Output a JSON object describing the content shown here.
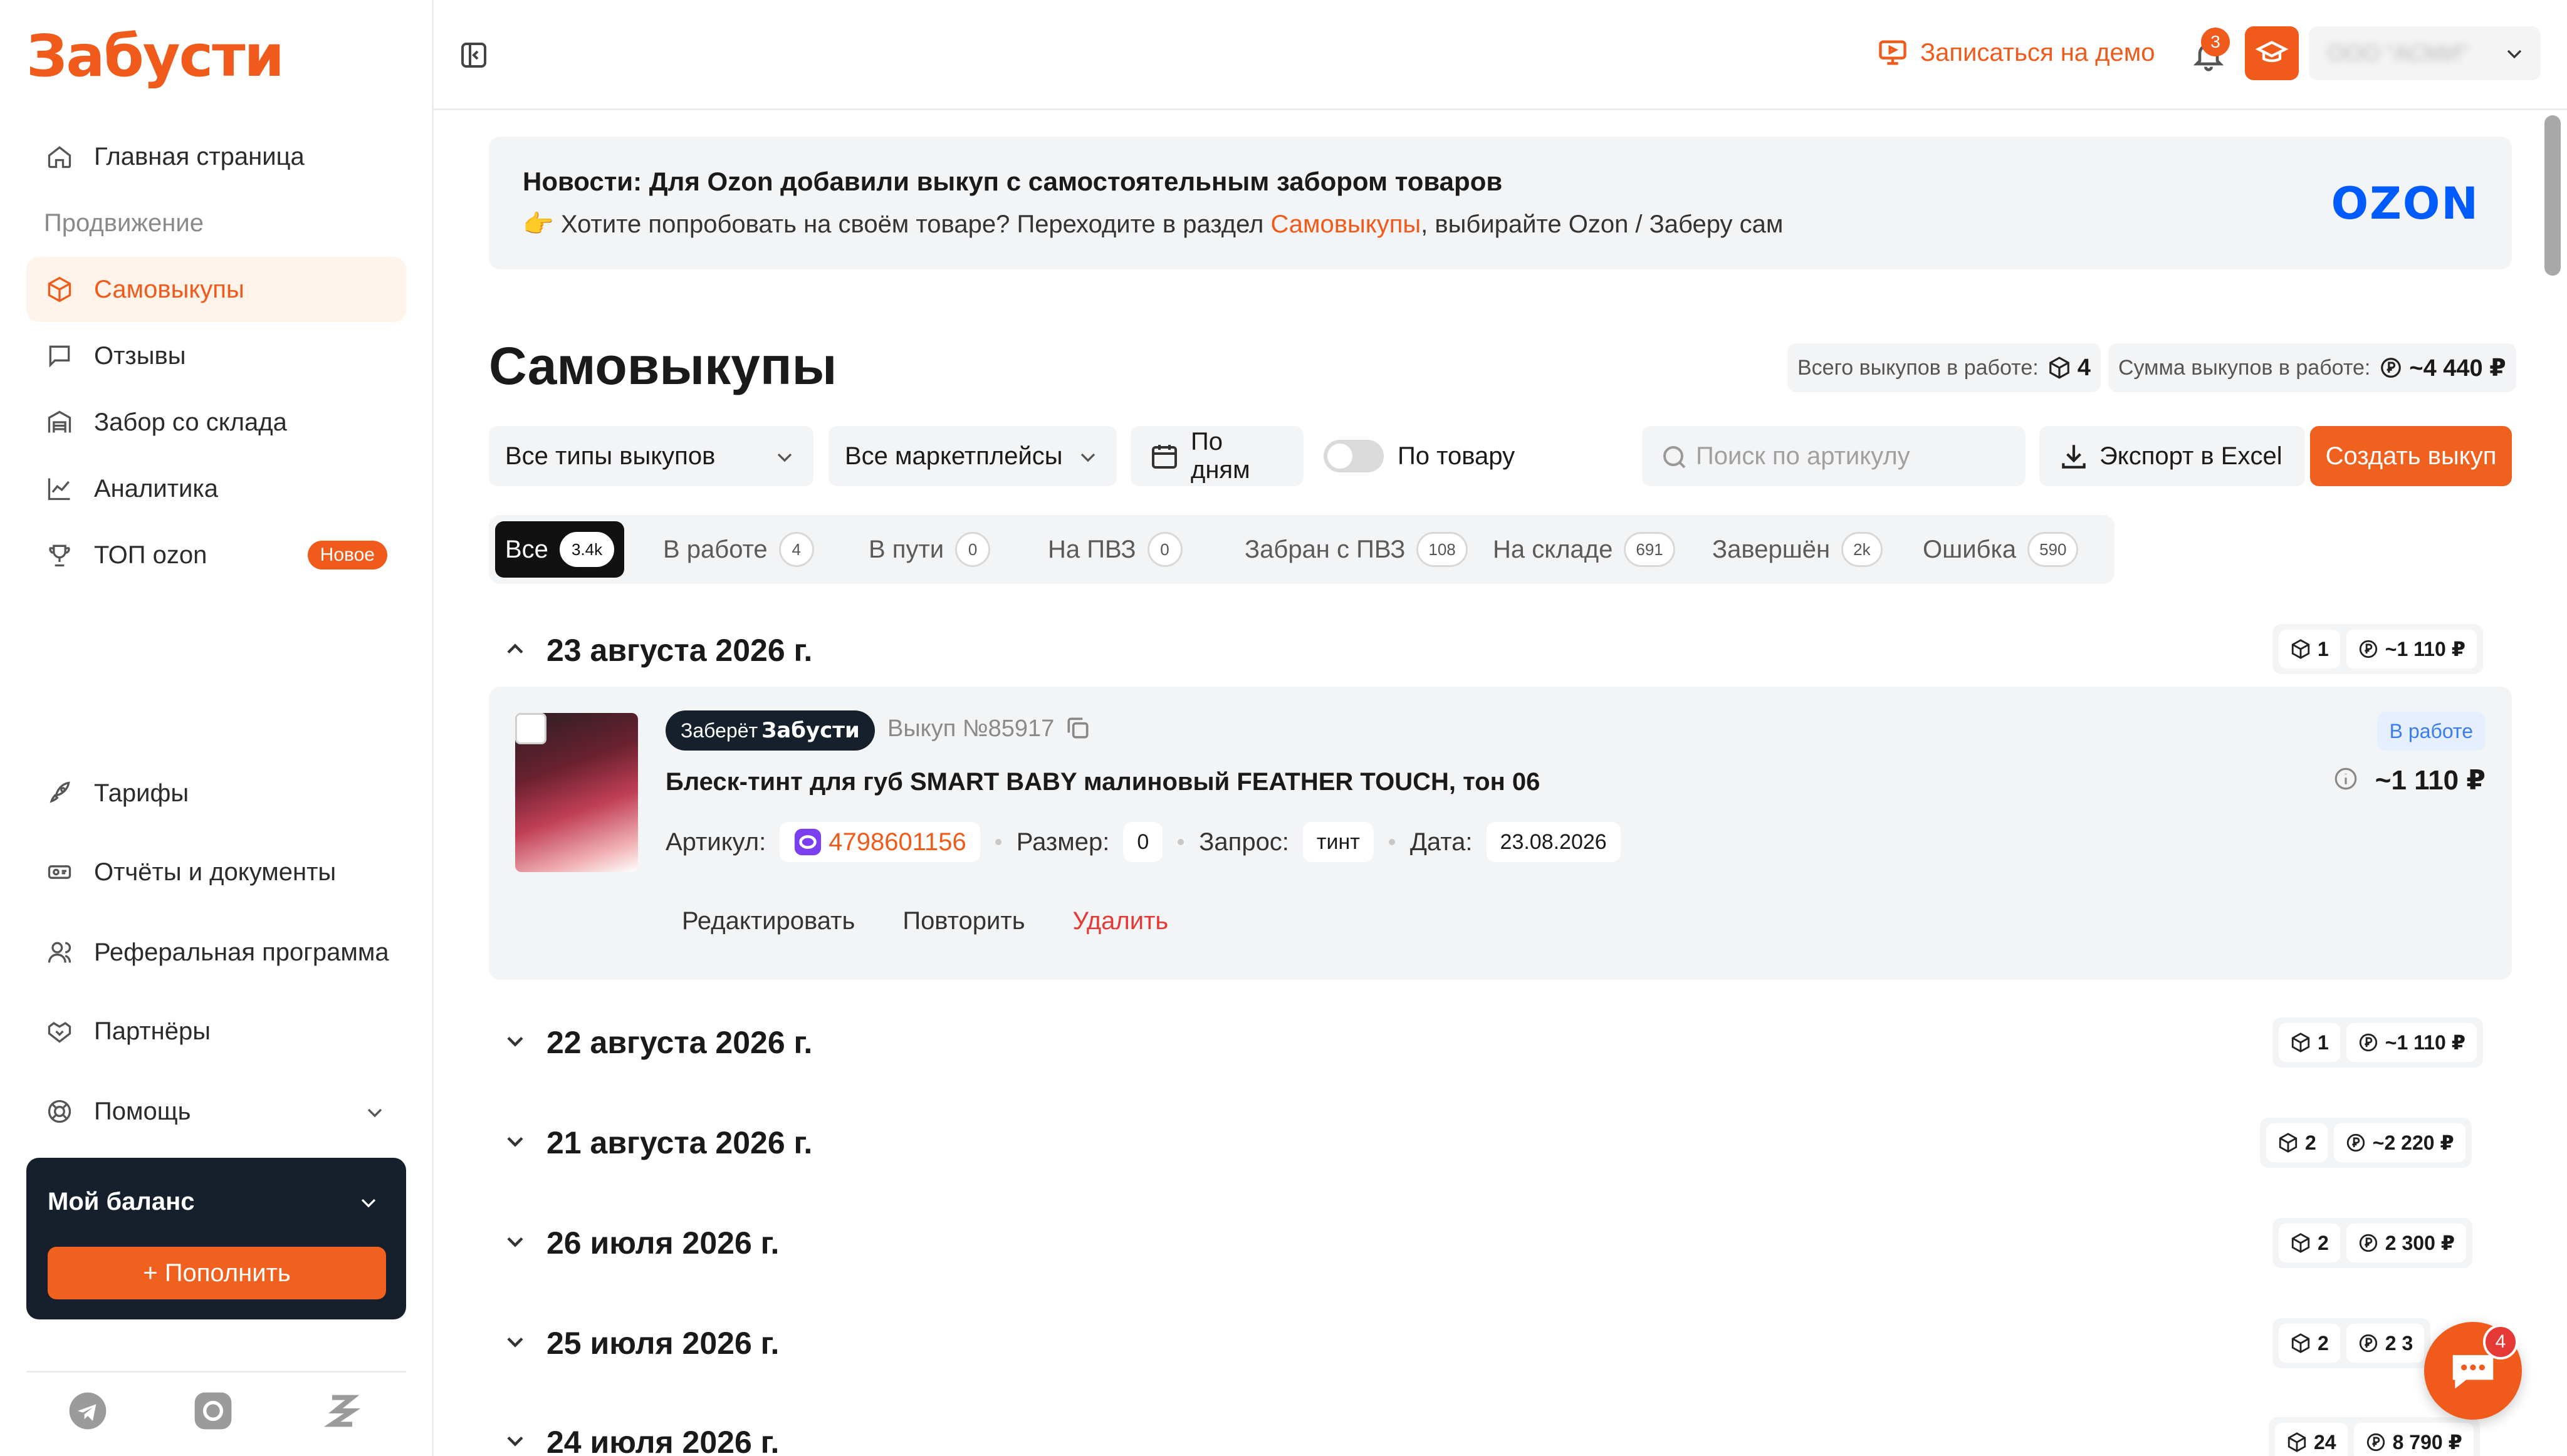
{
  "app": {
    "logo_text": "Забусти",
    "brand_color": "#f05a1a"
  },
  "sidebar": {
    "items_top": [
      {
        "label": "Главная страница",
        "icon": "home-icon"
      },
      {
        "label": "Продвижение",
        "section": true
      },
      {
        "label": "Самовыкупы",
        "icon": "box-icon",
        "active": true
      },
      {
        "label": "Отзывы",
        "icon": "chat-icon"
      },
      {
        "label": "Забор со склада",
        "icon": "warehouse-icon"
      },
      {
        "label": "Аналитика",
        "icon": "chart-icon"
      },
      {
        "label": "ТОП ozon",
        "icon": "trophy-icon",
        "badge": "Новое"
      }
    ],
    "items_bottom": [
      {
        "label": "Тарифы",
        "icon": "rocket-icon"
      },
      {
        "label": "Отчёты и документы",
        "icon": "ticket-icon"
      },
      {
        "label": "Реферальная программа",
        "icon": "users-icon"
      },
      {
        "label": "Партнёры",
        "icon": "handshake-icon"
      },
      {
        "label": "Помощь",
        "icon": "lifebuoy-icon"
      }
    ],
    "balance": {
      "title": "Мой баланс",
      "topup_label": "+ Пополнить"
    },
    "footer_icons": [
      "telegram-icon",
      "vk-icon",
      "zabusti-icon"
    ]
  },
  "topbar": {
    "demo_label": "Записаться на демо",
    "notifications_count": "3",
    "user_name": "ООО \"АСМИ\""
  },
  "news": {
    "title": "Новости: Для Ozon добавили выкуп с самостоятельным забором товаров",
    "text_before": "👉 Хотите попробовать на своём товаре? Переходите в раздел ",
    "text_link": "Самовыкупы",
    "text_after": ", выбирайте Ozon / Заберу сам",
    "logo": "OZON"
  },
  "page": {
    "title": "Самовыкупы",
    "total_label": "Всего выкупов в работе:",
    "total_value": "4",
    "sum_label": "Сумма выкупов в работе:",
    "sum_value": "~4 440 ₽"
  },
  "filters": {
    "type_label": "Все типы выкупов",
    "marketplace_label": "Все маркетплейсы",
    "by_days_label": "По дням",
    "by_product_label": "По товару",
    "search_placeholder": "Поиск по артикулу",
    "export_label": "Экспорт в Excel",
    "create_label": "Создать выкуп"
  },
  "tabs": [
    {
      "label": "Все",
      "count": "3.4k",
      "active": true
    },
    {
      "label": "В работе",
      "count": "4"
    },
    {
      "label": "В пути",
      "count": "0"
    },
    {
      "label": "На ПВЗ",
      "count": "0"
    },
    {
      "label": "Забран с ПВЗ",
      "count": "108"
    },
    {
      "label": "На складе",
      "count": "691"
    },
    {
      "label": "Завершён",
      "count": "2k"
    },
    {
      "label": "Ошибка",
      "count": "590"
    }
  ],
  "groups": [
    {
      "date": "23 августа 2026 г.",
      "count": "1",
      "sum": "~1 110 ₽",
      "expanded": true
    },
    {
      "date": "22 августа 2026 г.",
      "count": "1",
      "sum": "~1 110 ₽"
    },
    {
      "date": "21 августа 2026 г.",
      "count": "2",
      "sum": "~2 220 ₽"
    },
    {
      "date": "26 июля 2026 г.",
      "count": "2",
      "sum": "2 300 ₽"
    },
    {
      "date": "25 июля 2026 г.",
      "count": "2",
      "sum": "2 3"
    },
    {
      "date": "24 июля 2026 г.",
      "count": "24",
      "sum": "8 790 ₽"
    }
  ],
  "order": {
    "pickup_prefix": "Заберёт",
    "pickup_brand": "Забусти",
    "order_number": "Выкуп №85917",
    "status": "В работе",
    "product_name": "Блеск-тинт для губ SMART BABY малиновый FEATHER TOUCH, тон 06",
    "price": "~1 110 ₽",
    "sku_label": "Артикул:",
    "sku": "4798601156",
    "size_label": "Размер:",
    "size": "0",
    "query_label": "Запрос:",
    "query": "тинт",
    "date_label": "Дата:",
    "date": "23.08.2026",
    "edit_label": "Редактировать",
    "repeat_label": "Повторить",
    "delete_label": "Удалить"
  },
  "chat": {
    "unread": "4"
  }
}
